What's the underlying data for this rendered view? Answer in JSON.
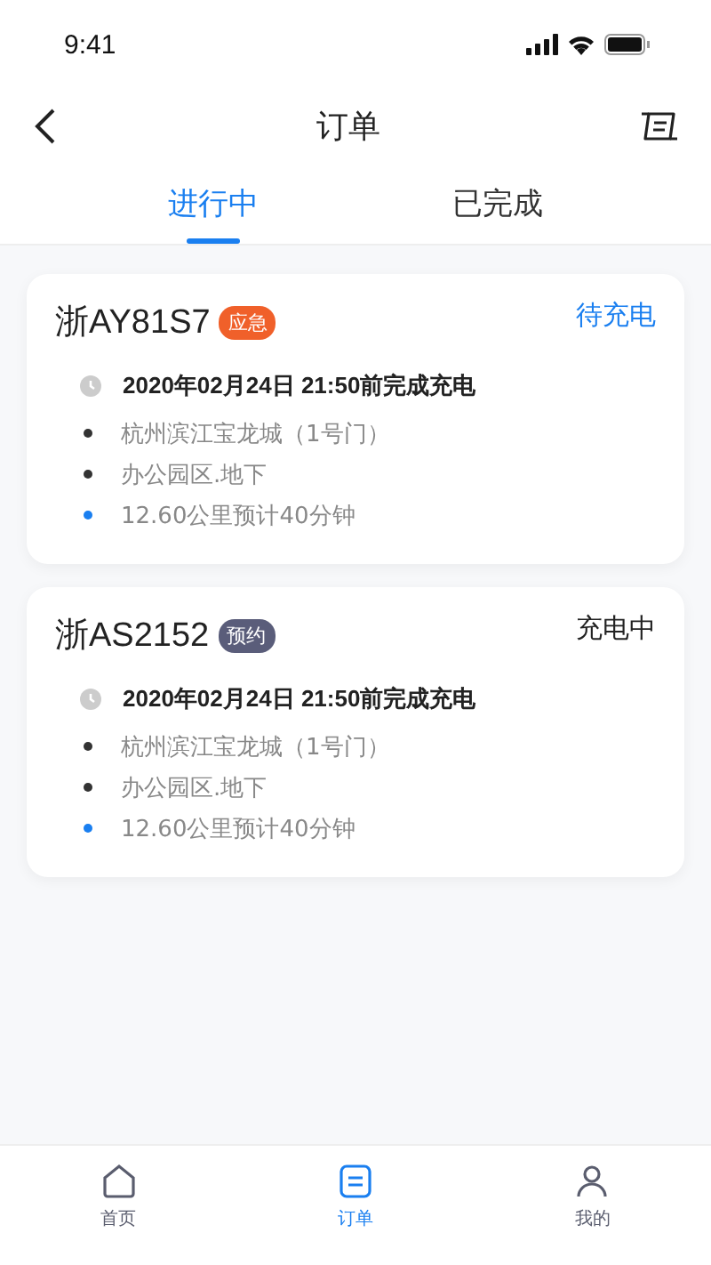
{
  "status_bar": {
    "time": "9:41"
  },
  "header": {
    "title": "订单"
  },
  "tabs": [
    {
      "label": "进行中",
      "selected": true
    },
    {
      "label": "已完成",
      "selected": false
    }
  ],
  "orders": [
    {
      "plate": "浙AY81S7",
      "tag": {
        "label": "应急",
        "color": "#f0602a"
      },
      "status": {
        "label": "待充电",
        "color": "#1a7ff0"
      },
      "deadline": "2020年02月24日 21:50前完成充电",
      "details": [
        {
          "text": "杭州滨江宝龙城（1号门）",
          "color": "#333333"
        },
        {
          "text": "办公园区.地下",
          "color": "#333333"
        },
        {
          "text": "12.60公里预计40分钟",
          "color": "#1a7ff0"
        }
      ]
    },
    {
      "plate": "浙AS2152",
      "tag": {
        "label": "预约",
        "color": "#5a5d7a"
      },
      "status": {
        "label": "充电中",
        "color": "#222222"
      },
      "deadline": "2020年02月24日 21:50前完成充电",
      "details": [
        {
          "text": "杭州滨江宝龙城（1号门）",
          "color": "#333333"
        },
        {
          "text": "办公园区.地下",
          "color": "#333333"
        },
        {
          "text": "12.60公里预计40分钟",
          "color": "#1a7ff0"
        }
      ]
    }
  ],
  "tab_bar": [
    {
      "label": "首页",
      "kind": "home",
      "selected": false
    },
    {
      "label": "订单",
      "kind": "orders",
      "selected": true
    },
    {
      "label": "我的",
      "kind": "profile",
      "selected": false
    }
  ]
}
